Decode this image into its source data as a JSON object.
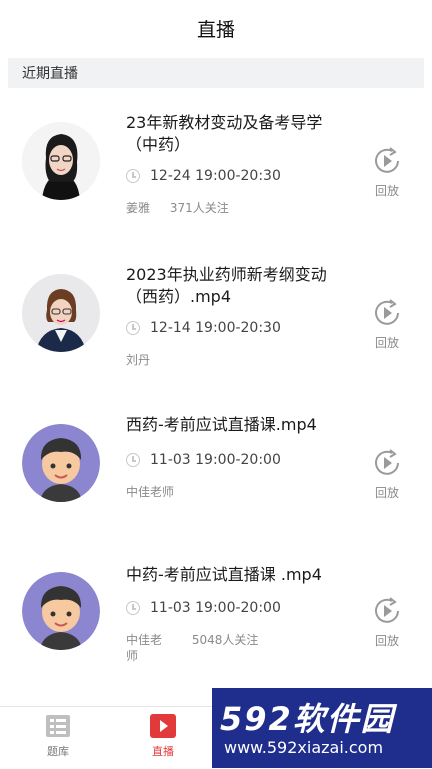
{
  "header": {
    "title": "直播"
  },
  "section": {
    "title": "近期直播"
  },
  "items": [
    {
      "title": "23年新教材变动及备考导学（中药）",
      "time": "12-24 19:00-20:30",
      "teacher": "姜雅",
      "followers": "371人关注",
      "action": "回放",
      "avatar_icon": "teacher-photo-female-glasses"
    },
    {
      "title": "2023年执业药师新考纲变动（西药）.mp4",
      "time": "12-14 19:00-20:30",
      "teacher": "刘丹",
      "followers": "",
      "action": "回放",
      "avatar_icon": "teacher-photo-female-suit"
    },
    {
      "title": "西药-考前应试直播课.mp4",
      "time": "11-03 19:00-20:00",
      "teacher": "中佳老师",
      "followers": "",
      "action": "回放",
      "avatar_icon": "cartoon-boy-avatar"
    },
    {
      "title": "中药-考前应试直播课 .mp4",
      "time": "11-03 19:00-20:00",
      "teacher": "中佳老师",
      "followers": "5048人关注",
      "action": "回放",
      "avatar_icon": "cartoon-boy-avatar"
    }
  ],
  "tabbar": {
    "tabs": [
      {
        "label": "题库",
        "icon": "question-bank-icon"
      },
      {
        "label": "直播",
        "icon": "live-play-icon",
        "active": true
      }
    ]
  },
  "watermark": {
    "brand": "592软件园",
    "url": "www.592xiazai.com"
  },
  "colors": {
    "accent": "#e23a3a",
    "section_bg": "#f1f2f4",
    "watermark_bg": "#1f2d8c"
  }
}
